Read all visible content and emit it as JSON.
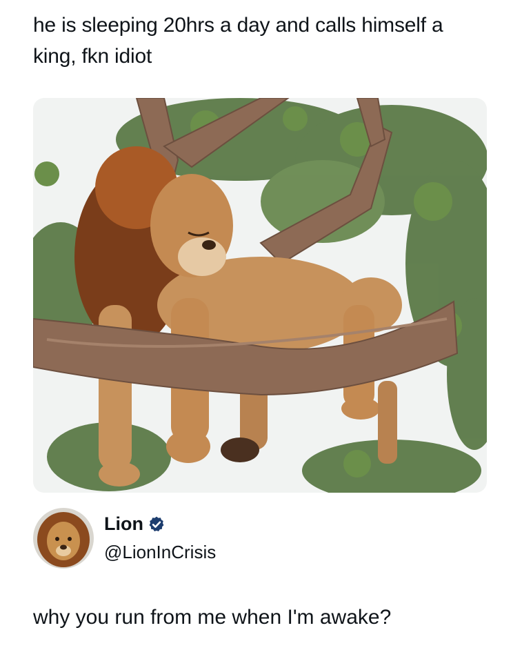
{
  "post": {
    "text": "he is sleeping 20hrs a day and calls himself a king, fkn idiot"
  },
  "media": {
    "subject": "lion sleeping on tree branch",
    "colors": {
      "sky": "#f1f3f2",
      "branch": "#8d6a55",
      "fur": "#c7925c",
      "mane": "#7a3d1a",
      "leaves": "#3f5e2c"
    }
  },
  "author": {
    "name": "Lion",
    "handle": "@LionInCrisis",
    "verified": true,
    "verified_color": "#1d9bf0"
  },
  "reply": {
    "text": "why you run from me when I'm awake?"
  }
}
